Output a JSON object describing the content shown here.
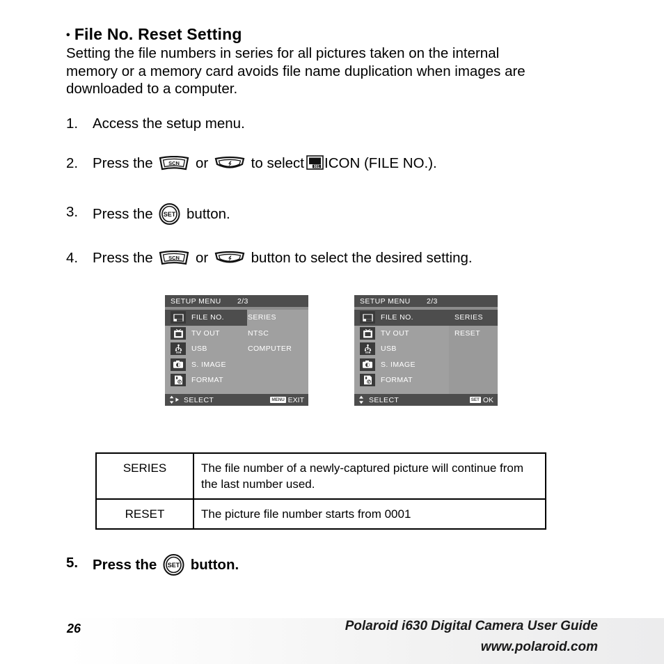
{
  "heading": {
    "bullet": "•",
    "text": "File No. Reset Setting"
  },
  "intro": {
    "line1": "Setting the file numbers in series for all pictures taken on the internal",
    "line2": "memory or a memory card avoids file name duplication when images are",
    "line3": "downloaded to a computer."
  },
  "steps": [
    {
      "num": "1.",
      "pre": "Access the setup menu.",
      "mid": "",
      "post": ""
    },
    {
      "num": "2.",
      "pre": "Press the",
      "mid": "or",
      "post": "to select",
      "tail": "ICON (FILE NO.)."
    },
    {
      "num": "3.",
      "pre": "Press the",
      "post": "button."
    },
    {
      "num": "4.",
      "pre": "Press the",
      "mid": "or",
      "post": "button to select the desired setting."
    },
    {
      "num": "5.",
      "pre": "Press the",
      "post": "button."
    }
  ],
  "buttons": {
    "scn_label": "SCN",
    "flash_label": "flash-self-timer",
    "set_label": "SET"
  },
  "lcd1": {
    "title": "SETUP MENU",
    "page": "2/3",
    "rows": [
      {
        "icon": "file-no-icon",
        "label": "FILE NO.",
        "value": "SERIES"
      },
      {
        "icon": "tv-out-icon",
        "label": "TV OUT",
        "value": "NTSC"
      },
      {
        "icon": "usb-icon",
        "label": "USB",
        "value": "COMPUTER"
      },
      {
        "icon": "s-image-icon",
        "label": "S. IMAGE",
        "value": ""
      },
      {
        "icon": "format-icon",
        "label": "FORMAT",
        "value": ""
      }
    ],
    "footer": {
      "select": "SELECT",
      "right_badge": "MENU",
      "right_label": "EXIT"
    }
  },
  "lcd2": {
    "title": "SETUP MENU",
    "page": "2/3",
    "rows": [
      {
        "icon": "file-no-icon",
        "label": "FILE NO."
      },
      {
        "icon": "tv-out-icon",
        "label": "TV OUT"
      },
      {
        "icon": "usb-icon",
        "label": "USB"
      },
      {
        "icon": "s-image-icon",
        "label": "S. IMAGE"
      },
      {
        "icon": "format-icon",
        "label": "FORMAT"
      }
    ],
    "options": [
      {
        "label": "SERIES",
        "selected": true
      },
      {
        "label": "RESET",
        "selected": false
      }
    ],
    "footer": {
      "select": "SELECT",
      "right_badge": "SET",
      "right_label": "OK"
    }
  },
  "desc_table": {
    "rows": [
      {
        "key": "SERIES",
        "line1": "The file number of a newly-captured picture will continue from",
        "line2": "the last number used."
      },
      {
        "key": "RESET",
        "line1": "The picture file number starts from 0001",
        "line2": ""
      }
    ]
  },
  "footer": {
    "page_number": "26",
    "guide": "Polaroid i630 Digital Camera User Guide",
    "website": "www.polaroid.com"
  },
  "colors": {
    "lcd_bg": "#a0a0a0",
    "lcd_bar": "#4d4d4d",
    "lcd_icon_bg": "#3a3a3a",
    "lcd_panel": "#9a9a9a",
    "text": "#000000"
  }
}
